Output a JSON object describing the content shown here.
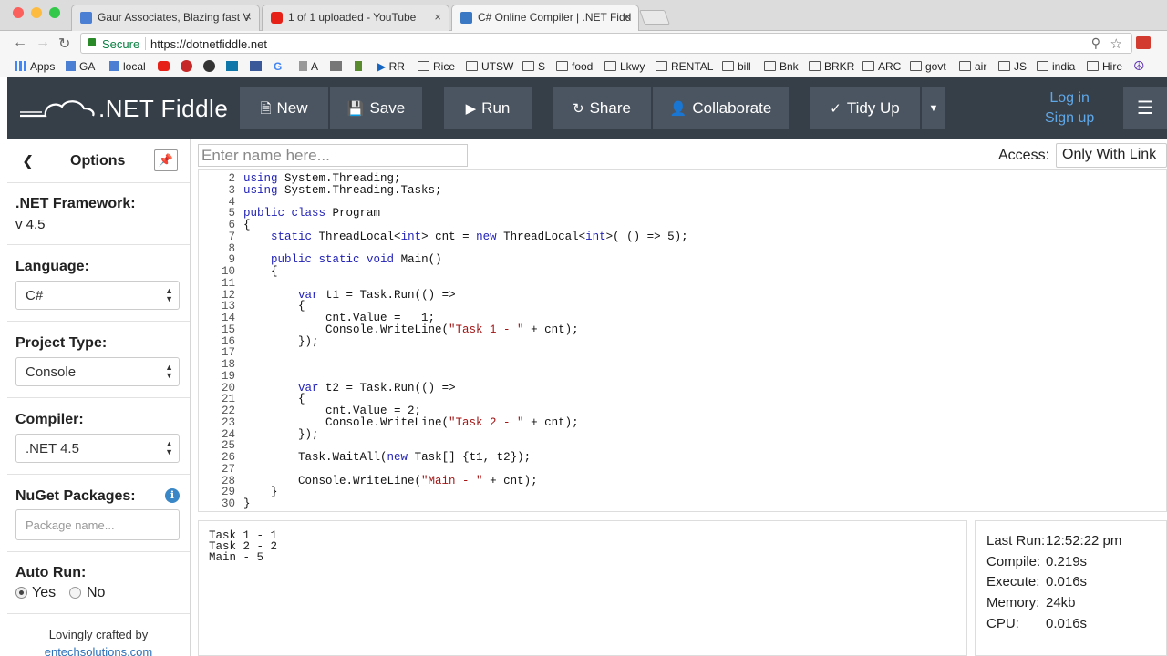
{
  "browser": {
    "tabs": [
      {
        "title": "Gaur Associates, Blazing fast V",
        "fav_color": "#4a7fd4"
      },
      {
        "title": "1 of 1 uploaded - YouTube",
        "fav_color": "#e62117"
      },
      {
        "title": "C# Online Compiler | .NET Fidd",
        "fav_color": "#3a78c4"
      }
    ],
    "close_glyph": "×",
    "secure_label": "Secure",
    "url": "https://dotnetfiddle.net",
    "bookmarks": [
      {
        "label": "Apps",
        "icon": "apps-icon"
      },
      {
        "label": "GA",
        "icon": "g-icon"
      },
      {
        "label": "local",
        "icon": "g-icon"
      },
      {
        "label": "",
        "icon": "youtube-icon"
      },
      {
        "label": "",
        "icon": "r-icon"
      },
      {
        "label": "",
        "icon": "a-icon"
      },
      {
        "label": "",
        "icon": "linkedin-icon"
      },
      {
        "label": "",
        "icon": "facebook-icon"
      },
      {
        "label": "G",
        "icon": "g-icon"
      },
      {
        "label": "A",
        "icon": "doc-icon"
      },
      {
        "label": "",
        "icon": "puzzle-icon"
      },
      {
        "label": "",
        "icon": "figure-icon"
      },
      {
        "label": "RR",
        "icon": "play-icon"
      },
      {
        "label": "Rice",
        "icon": "folder-icon"
      },
      {
        "label": "UTSW",
        "icon": "folder-icon"
      },
      {
        "label": "S",
        "icon": "folder-icon"
      },
      {
        "label": "food",
        "icon": "folder-icon"
      },
      {
        "label": "Lkwy",
        "icon": "folder-icon"
      },
      {
        "label": "RENTAL",
        "icon": "folder-icon"
      },
      {
        "label": "bill",
        "icon": "folder-icon"
      },
      {
        "label": "Bnk",
        "icon": "folder-icon"
      },
      {
        "label": "BRKR",
        "icon": "folder-icon"
      },
      {
        "label": "ARC",
        "icon": "folder-icon"
      },
      {
        "label": "govt",
        "icon": "folder-icon"
      },
      {
        "label": "air",
        "icon": "folder-icon"
      },
      {
        "label": "JS",
        "icon": "folder-icon"
      },
      {
        "label": "india",
        "icon": "folder-icon"
      },
      {
        "label": "Hire",
        "icon": "folder-icon"
      }
    ]
  },
  "header": {
    "logo": ".NET Fiddle",
    "buttons": {
      "new": "New",
      "save": "Save",
      "run": "Run",
      "share": "Share",
      "collaborate": "Collaborate",
      "tidy": "Tidy Up"
    },
    "login": "Log in",
    "signup": "Sign up"
  },
  "sidebar": {
    "title": "Options",
    "framework_label": ".NET Framework:",
    "framework_value": "v 4.5",
    "language_label": "Language:",
    "language_value": "C#",
    "project_label": "Project Type:",
    "project_value": "Console",
    "compiler_label": "Compiler:",
    "compiler_value": ".NET 4.5",
    "nuget_label": "NuGet Packages:",
    "nuget_placeholder": "Package name...",
    "autorun_label": "Auto Run:",
    "autorun_yes": "Yes",
    "autorun_no": "No",
    "autorun_selected": "Yes",
    "footer_line1": "Lovingly crafted by",
    "footer_line2": "entechsolutions.com"
  },
  "editor": {
    "name_placeholder": "Enter name here...",
    "access_label": "Access:",
    "access_value": "Only With Link",
    "lines": [
      {
        "n": "2",
        "t": [
          [
            "kw",
            "using"
          ],
          [
            "",
            "System.Threading;"
          ]
        ]
      },
      {
        "n": "3",
        "t": [
          [
            "kw",
            "using"
          ],
          [
            "",
            "System.Threading.Tasks;"
          ]
        ]
      },
      {
        "n": "4",
        "t": []
      },
      {
        "n": "5",
        "t": [
          [
            "kw",
            "public class"
          ],
          [
            "",
            "Program"
          ]
        ]
      },
      {
        "n": "6",
        "t": [
          [
            "",
            "{"
          ]
        ]
      },
      {
        "n": "7",
        "t": [
          [
            "",
            "    "
          ],
          [
            "kw",
            "static"
          ],
          [
            "",
            " ThreadLocal<"
          ],
          [
            "kw",
            "int"
          ],
          [
            "",
            "> cnt = "
          ],
          [
            "kw",
            "new"
          ],
          [
            "",
            " ThreadLocal<"
          ],
          [
            "kw",
            "int"
          ],
          [
            "",
            ">( () => 5);"
          ]
        ]
      },
      {
        "n": "8",
        "t": []
      },
      {
        "n": "9",
        "t": [
          [
            "",
            "    "
          ],
          [
            "kw",
            "public static void"
          ],
          [
            "",
            "Main()"
          ]
        ]
      },
      {
        "n": "10",
        "t": [
          [
            "",
            "    {"
          ]
        ]
      },
      {
        "n": "11",
        "t": []
      },
      {
        "n": "12",
        "t": [
          [
            "",
            "        "
          ],
          [
            "kw",
            "var"
          ],
          [
            "",
            "t1 = Task.Run(() =>"
          ]
        ]
      },
      {
        "n": "13",
        "t": [
          [
            "",
            "        {"
          ]
        ]
      },
      {
        "n": "14",
        "t": [
          [
            "",
            "            cnt.Value =   1;"
          ]
        ]
      },
      {
        "n": "15",
        "t": [
          [
            "",
            "            Console.WriteLine("
          ],
          [
            "st",
            "\"Task 1 - \""
          ],
          [
            "",
            " + cnt);"
          ]
        ]
      },
      {
        "n": "16",
        "t": [
          [
            "",
            "        });"
          ]
        ]
      },
      {
        "n": "17",
        "t": []
      },
      {
        "n": "18",
        "t": []
      },
      {
        "n": "19",
        "t": []
      },
      {
        "n": "20",
        "t": [
          [
            "",
            "        "
          ],
          [
            "kw",
            "var"
          ],
          [
            "",
            "t2 = Task.Run(() =>"
          ]
        ]
      },
      {
        "n": "21",
        "t": [
          [
            "",
            "        {"
          ]
        ]
      },
      {
        "n": "22",
        "t": [
          [
            "",
            "            cnt.Value = 2;"
          ]
        ]
      },
      {
        "n": "23",
        "t": [
          [
            "",
            "            Console.WriteLine("
          ],
          [
            "st",
            "\"Task 2 - \""
          ],
          [
            "",
            " + cnt);"
          ]
        ]
      },
      {
        "n": "24",
        "t": [
          [
            "",
            "        });"
          ]
        ]
      },
      {
        "n": "25",
        "t": []
      },
      {
        "n": "26",
        "t": [
          [
            "",
            "        Task.WaitAll("
          ],
          [
            "kw",
            "new"
          ],
          [
            "",
            "Task[] {t1, t2});"
          ]
        ]
      },
      {
        "n": "27",
        "t": []
      },
      {
        "n": "28",
        "t": [
          [
            "",
            "        Console.WriteLine("
          ],
          [
            "st",
            "\"Main - \""
          ],
          [
            "",
            " + cnt);"
          ]
        ]
      },
      {
        "n": "29",
        "t": [
          [
            "",
            "    }"
          ]
        ]
      },
      {
        "n": "30",
        "t": [
          [
            "",
            "}"
          ]
        ]
      }
    ]
  },
  "output": {
    "lines": [
      "Task 1 - 1",
      "Task 2 - 2",
      "Main - 5"
    ]
  },
  "stats": {
    "last_run_label": "Last Run:",
    "last_run_value": "12:52:22 pm",
    "compile_label": "Compile:",
    "compile_value": "0.219s",
    "execute_label": "Execute:",
    "execute_value": "0.016s",
    "memory_label": "Memory:",
    "memory_value": "24kb",
    "cpu_label": "CPU:",
    "cpu_value": "0.016s"
  },
  "colors": {
    "header_bg": "#363e48",
    "button_bg": "#4b5561",
    "link_blue": "#5fa8e8",
    "keyword": "#1f1fb6",
    "string": "#a31515"
  }
}
